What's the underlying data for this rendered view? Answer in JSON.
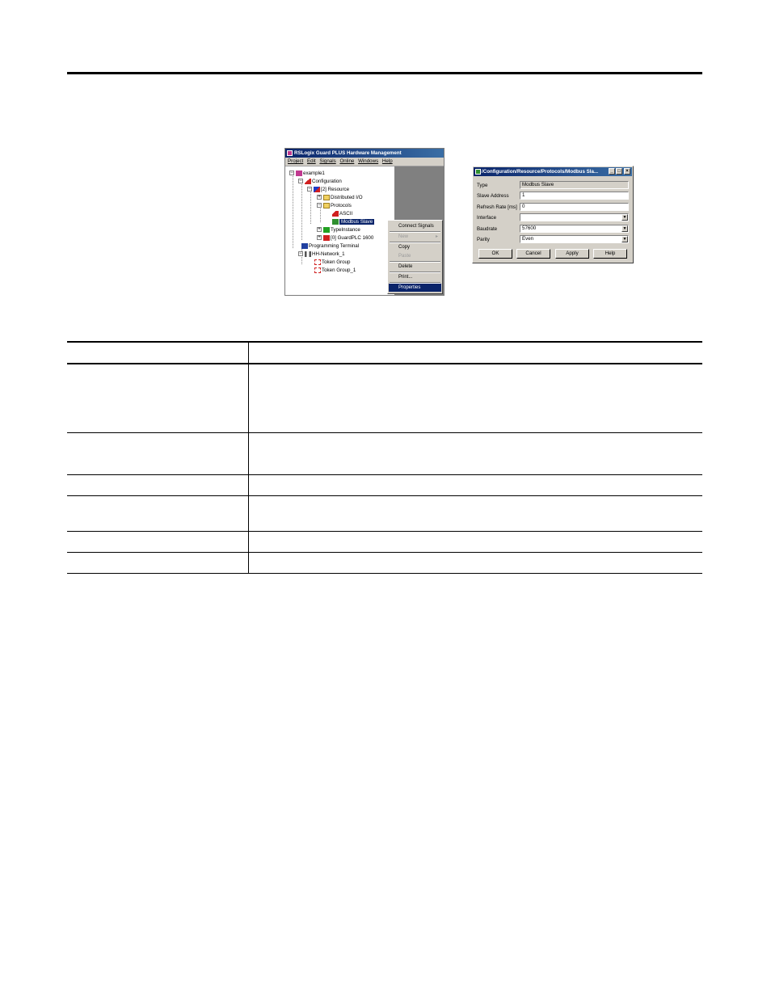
{
  "hw_window": {
    "title": "RSLogix Guard PLUS Hardware Management",
    "menu": [
      "Project",
      "Edit",
      "Signals",
      "Online",
      "Windows",
      "Help"
    ],
    "tree": [
      {
        "label": "example1"
      },
      {
        "label": "Configuration"
      },
      {
        "label": "[2] Resource"
      },
      {
        "label": "Distributed I/O"
      },
      {
        "label": "Protocols"
      },
      {
        "label": "ASCII"
      },
      {
        "label": "Modbus Slave"
      },
      {
        "label": "TypeInstance"
      },
      {
        "label": "[0] GuardPLC 1600"
      },
      {
        "label": "Programming Terminal"
      },
      {
        "label": "HH-Network_1"
      },
      {
        "label": "Token Group"
      },
      {
        "label": "Token Group_1"
      }
    ]
  },
  "context_menu": {
    "items": [
      {
        "label": "Connect Signals"
      },
      {
        "label": "New"
      },
      {
        "label": "Copy"
      },
      {
        "label": "Paste"
      },
      {
        "label": "Delete"
      },
      {
        "label": "Print..."
      },
      {
        "label": "Properties"
      }
    ]
  },
  "dialog": {
    "title": "/Configuration/Resource/Protocols/Modbus Sla...",
    "fields": [
      {
        "label": "Type",
        "value": "Modbus Slave"
      },
      {
        "label": "Slave Address",
        "value": "1"
      },
      {
        "label": "Refresh Rate [ms]",
        "value": "0"
      },
      {
        "label": "Interface",
        "value": ""
      },
      {
        "label": "Baudrate",
        "value": "57600"
      },
      {
        "label": "Parity",
        "value": "Even"
      }
    ],
    "buttons": {
      "ok": "OK",
      "cancel": "Cancel",
      "apply": "Apply",
      "help": "Help"
    },
    "winbuttons": {
      "minimize": "_",
      "maximize": "□",
      "close": "×"
    }
  }
}
